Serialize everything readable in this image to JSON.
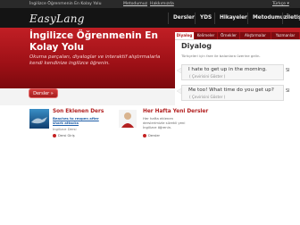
{
  "topbar": {
    "tagline": "İngilizce Öğrenmenin En Kolay Yolu",
    "link1": "Metodumuz",
    "link2": "Hakkımızda",
    "right": "Türkçe ▾"
  },
  "logo": {
    "text": "EasyLang"
  },
  "nav": {
    "items": [
      "Dersler",
      "YDS",
      "Hikayeler",
      "Metodumuz",
      "İletişim"
    ]
  },
  "hero": {
    "title": "İngilizce Öğrenmenin En Kolay Yolu",
    "text": "Okuma parçaları, diyaloglar ve interaktif alıştırmalarla kendi kendinize ingilizce öğrenin.",
    "button": "Dersler »"
  },
  "panel": {
    "tabs": [
      "Diyalog",
      "Kelimeler",
      "Örnekler",
      "Alıştırmalar",
      "Yazmanlar"
    ],
    "title": "Diyalog",
    "subtitle": "Türkçeleri için fare ile balonlara üzerine gelin.",
    "bubbles": [
      {
        "text": "I hate to get up in the morning.",
        "sub": "( Çevirisini Göster )"
      },
      {
        "text": "Me too! What time do you get up?",
        "sub": "( Çevirisini Göster )"
      }
    ],
    "side1": "Sl",
    "side2": "Sl"
  },
  "latest": {
    "title": "Son Eklenen Ders",
    "link": "Beaches to reopen after shark attacks",
    "sub": "Ingilizce Dersi",
    "button": "Dersi Giriş"
  },
  "weekly": {
    "title": "Her Hafta Yeni Dersler",
    "text": "Her hafta eklenen derslerimizle sürekli yeni İngilizce öğrenin.",
    "button": "Dersler"
  },
  "colors": {
    "accent": "#b21e1e",
    "navBg": "#141414",
    "heroTop": "#c11f25",
    "heroBottom": "#7c0a0e"
  }
}
